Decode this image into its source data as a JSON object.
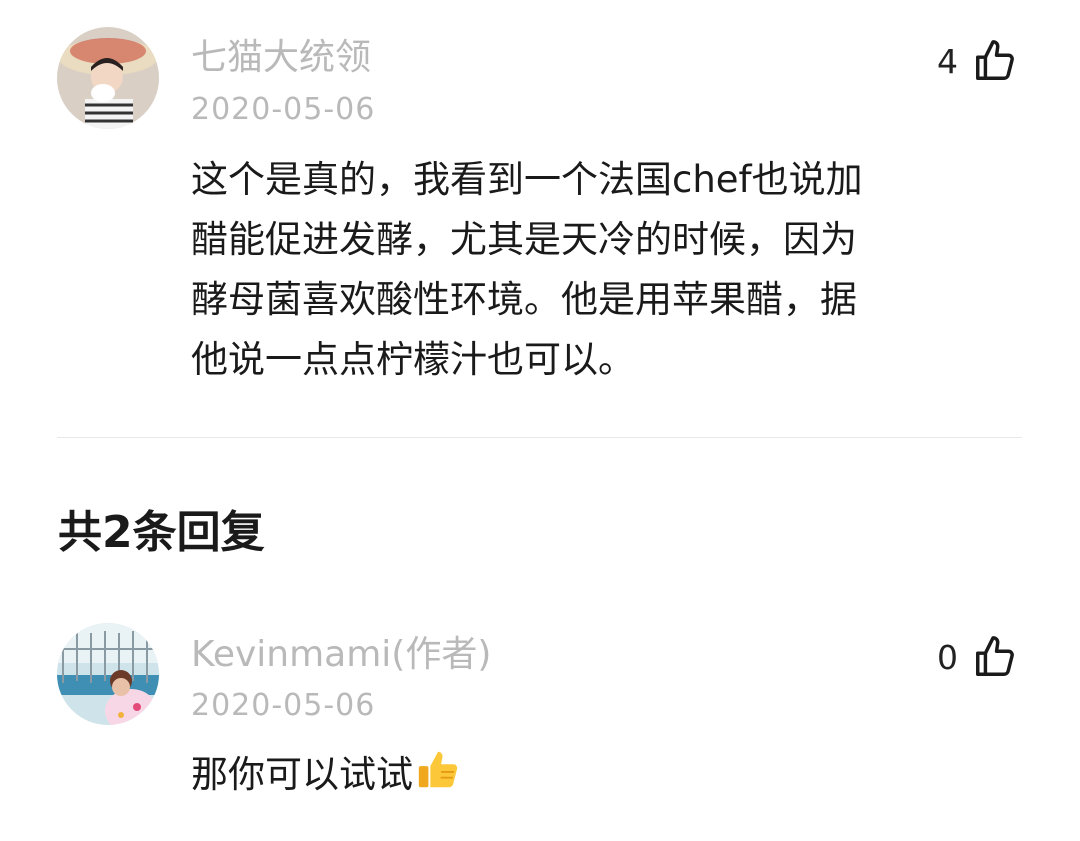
{
  "comment": {
    "username": "七猫大统领",
    "date": "2020-05-06",
    "like_count": "4",
    "text_lines": [
      "这个是真的，我看到一个法国chef也说加",
      "醋能促进发酵，尤其是天冷的时候，因为",
      "酵母菌喜欢酸性环境。他是用苹果醋，据",
      "他说一点点柠檬汁也可以。"
    ]
  },
  "replies": {
    "header": "共2条回复",
    "items": [
      {
        "username": "Kevinmami(作者)",
        "date": "2020-05-06",
        "like_count": "0",
        "text": "那你可以试试",
        "emoji": "thumbs-up-emoji"
      }
    ]
  },
  "icons": {
    "like": "thumbs-up-outline-icon"
  },
  "colors": {
    "meta_text": "#b9b9b9",
    "body_text": "#1a1a1a",
    "divider": "#e8e8e8"
  }
}
